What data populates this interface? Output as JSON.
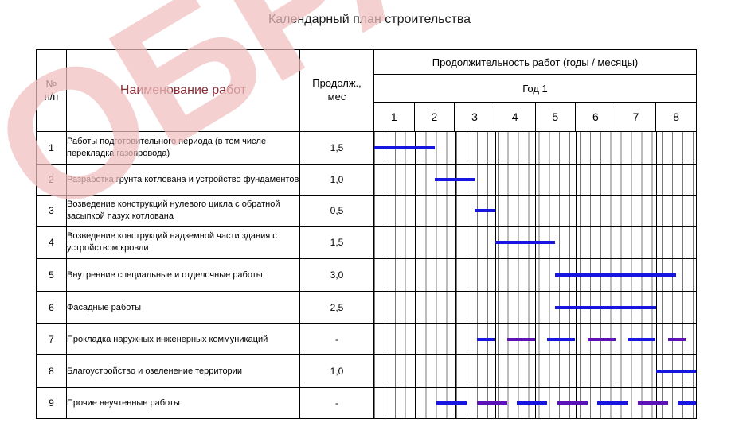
{
  "title": "Календарный план строительства",
  "watermark": {
    "text": "ОБРАЗЕЦ",
    "color": "#f0bfbf"
  },
  "header": {
    "col_no": "№\nп/п",
    "col_no_line1": "№",
    "col_no_line2": "п/п",
    "col_name": "Наименование работ",
    "col_duration_line1": "Продолж.,",
    "col_duration_line2": "мес",
    "group_title": "Продолжительность работ (годы / месяцы)",
    "year_label": "Год 1",
    "months": [
      "1",
      "2",
      "3",
      "4",
      "5",
      "6",
      "7",
      "8"
    ]
  },
  "colors": {
    "bar_blue": "#1616e0",
    "bar_violet": "#5b13b8",
    "name_header": "#8c2b36",
    "grid": "#000000",
    "week_grid": "#7a7a7a"
  },
  "rows": [
    {
      "no": "1",
      "name": "Работы подготовительного периода (в том числе перекладка газопровода)",
      "duration": "1,5"
    },
    {
      "no": "2",
      "name": "Разработка грунта котлована и устройство фундаментов",
      "duration": "1,0"
    },
    {
      "no": "3",
      "name": "Возведение конструкций нулевого цикла с обратной засыпкой пазух котлована",
      "duration": "0,5"
    },
    {
      "no": "4",
      "name": "Возведение конструкций надземной части здания с устройством кровли",
      "duration": "1,5"
    },
    {
      "no": "5",
      "name": "Внутренние специальные и отделочные работы",
      "duration": "3,0"
    },
    {
      "no": "6",
      "name": "Фасадные работы",
      "duration": "2,5"
    },
    {
      "no": "7",
      "name": "Прокладка наружных инженерных коммуникаций",
      "duration": "-"
    },
    {
      "no": "8",
      "name": "Благоустройство и озеленение территории",
      "duration": "1,0"
    },
    {
      "no": "9",
      "name": "Прочие неучтенные работы",
      "duration": "-"
    }
  ],
  "chart_data": {
    "type": "bar",
    "title": "Календарный план строительства",
    "xlabel": "Продолжительность работ (годы / месяцы)",
    "ylabel": "Наименование работ",
    "xlim": [
      0,
      8
    ],
    "x_unit": "месяц",
    "year": "Год 1",
    "categories": [
      "Работы подготовительного периода (в том числе перекладка газопровода)",
      "Разработка грунта котлована и устройство фундаментов",
      "Возведение конструкций нулевого цикла с обратной засыпкой пазух котлована",
      "Возведение конструкций надземной части здания с устройством кровли",
      "Внутренние специальные и отделочные работы",
      "Фасадные работы",
      "Прокладка наружных инженерных коммуникаций",
      "Благоустройство и озеленение территории",
      "Прочие неучтенные работы"
    ],
    "durations_months": [
      1.5,
      1.0,
      0.5,
      1.5,
      3.0,
      2.5,
      null,
      1.0,
      null
    ],
    "tasks": [
      {
        "row": 1,
        "duration": 1.5,
        "segments": [
          {
            "start": 0.0,
            "end": 1.5
          }
        ]
      },
      {
        "row": 2,
        "duration": 1.0,
        "segments": [
          {
            "start": 1.5,
            "end": 2.5
          }
        ]
      },
      {
        "row": 3,
        "duration": 0.5,
        "segments": [
          {
            "start": 2.5,
            "end": 3.0
          }
        ]
      },
      {
        "row": 4,
        "duration": 1.5,
        "segments": [
          {
            "start": 3.0,
            "end": 4.5
          }
        ]
      },
      {
        "row": 5,
        "duration": 3.0,
        "segments": [
          {
            "start": 4.5,
            "end": 7.5
          }
        ]
      },
      {
        "row": 6,
        "duration": 2.5,
        "segments": [
          {
            "start": 4.5,
            "end": 7.0
          }
        ]
      },
      {
        "row": 7,
        "duration": null,
        "segments": [
          {
            "start": 2.55,
            "end": 3.0
          },
          {
            "start": 3.3,
            "end": 4.0
          },
          {
            "start": 4.3,
            "end": 5.0
          },
          {
            "start": 5.3,
            "end": 6.0
          },
          {
            "start": 6.3,
            "end": 7.0
          },
          {
            "start": 7.3,
            "end": 7.75
          }
        ]
      },
      {
        "row": 8,
        "duration": 1.0,
        "segments": [
          {
            "start": 7.0,
            "end": 8.0
          }
        ]
      },
      {
        "row": 9,
        "duration": null,
        "segments": [
          {
            "start": 1.55,
            "end": 2.3
          },
          {
            "start": 2.55,
            "end": 3.3
          },
          {
            "start": 3.55,
            "end": 4.3
          },
          {
            "start": 4.55,
            "end": 5.3
          },
          {
            "start": 5.55,
            "end": 6.3
          },
          {
            "start": 6.55,
            "end": 7.3
          },
          {
            "start": 7.55,
            "end": 8.0
          }
        ]
      }
    ],
    "bar_color": "#1616e0",
    "grid": true,
    "legend": null
  }
}
